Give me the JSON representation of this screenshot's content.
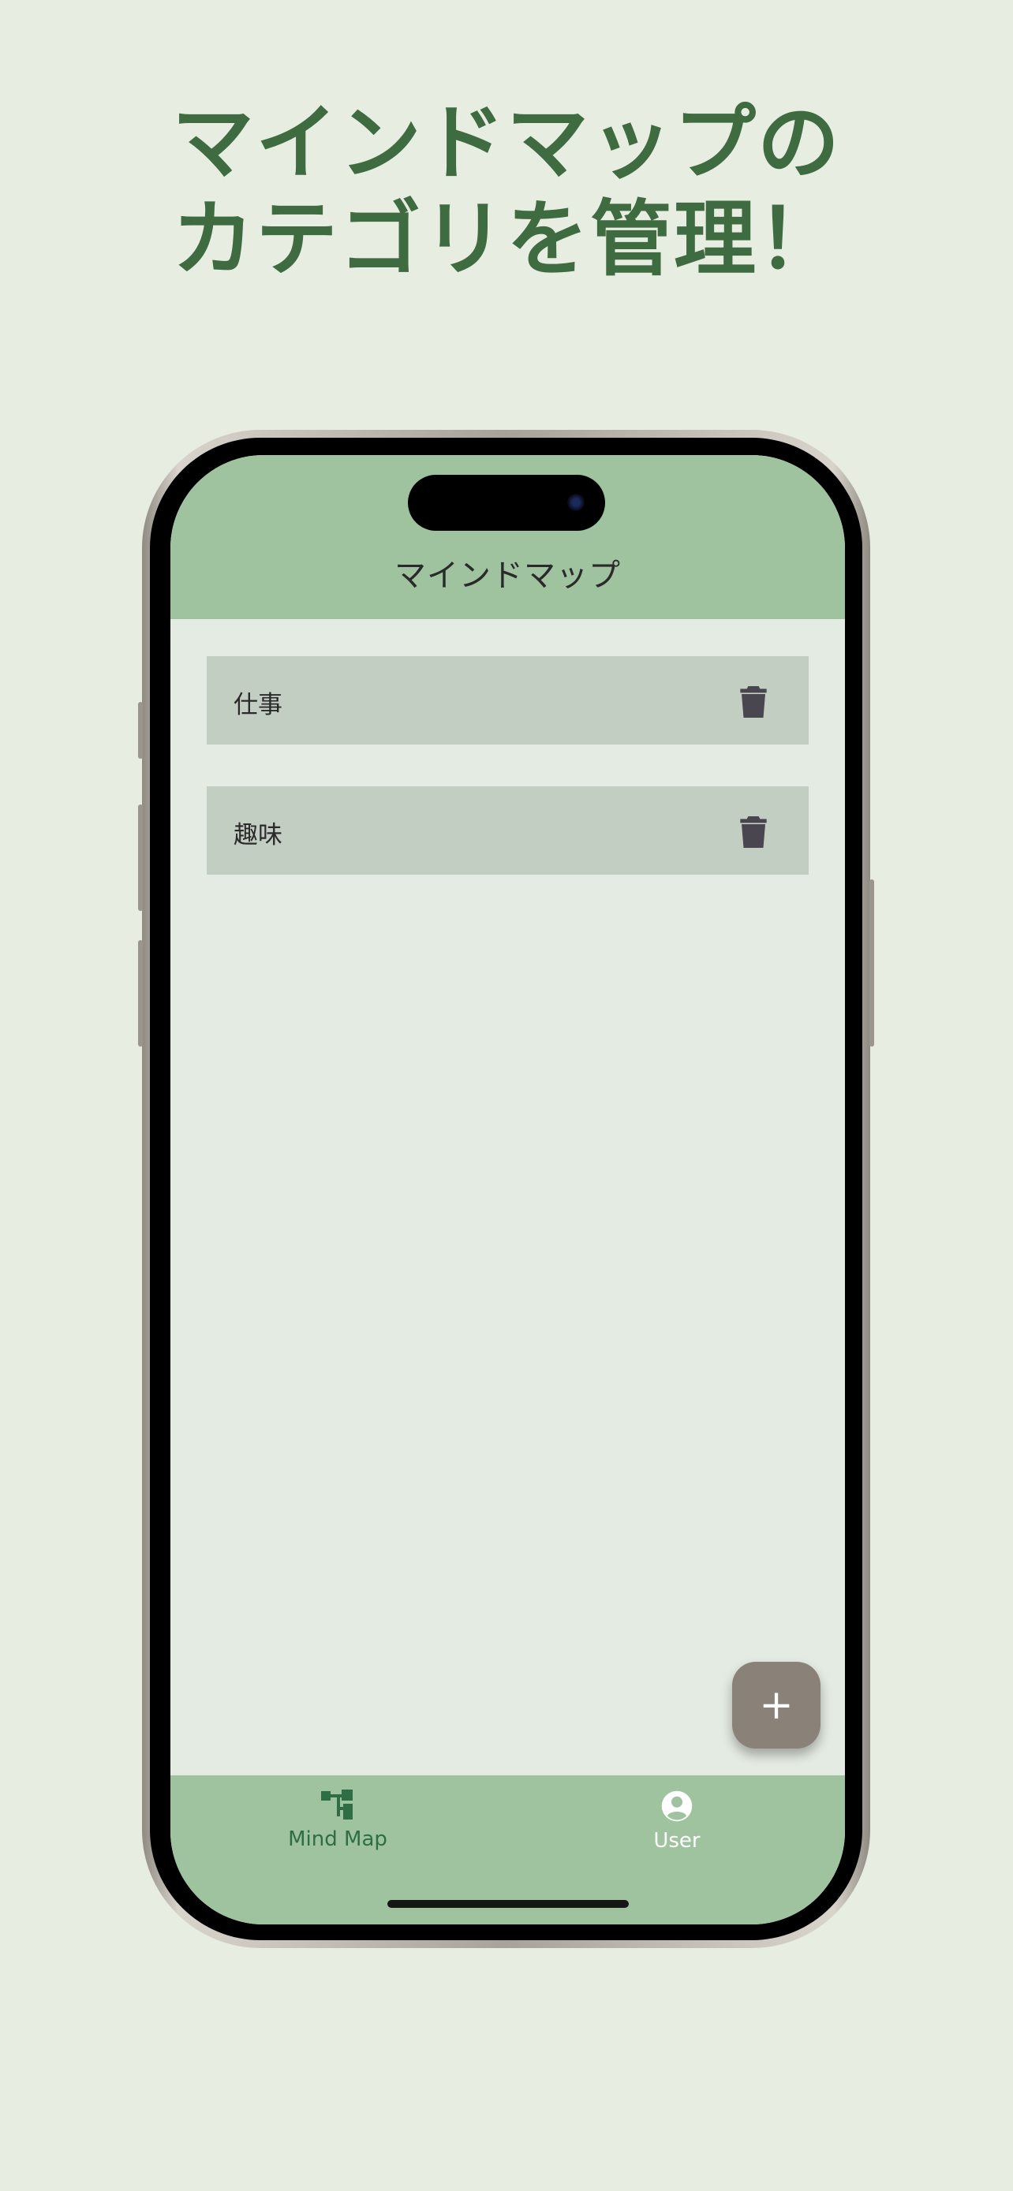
{
  "headline": {
    "line1": "マインドマップの",
    "line2": "カテゴリを管理！"
  },
  "app": {
    "title": "マインドマップ",
    "categories": [
      {
        "label": "仕事",
        "icon": "trash-icon"
      },
      {
        "label": "趣味",
        "icon": "trash-icon"
      }
    ],
    "fab": {
      "label": "+",
      "icon": "plus-icon"
    },
    "bottom_nav": [
      {
        "label": "Mind Map",
        "icon": "mind-map-icon",
        "active": true
      },
      {
        "label": "User",
        "icon": "account-circle-icon",
        "active": false
      }
    ]
  },
  "colors": {
    "background": "#e8ede2",
    "headline": "#3f6b40",
    "app_bar": "#9fc39f",
    "card": "#c3cec2",
    "fab": "#8a8178",
    "nav_active": "#2e6e45",
    "nav_inactive": "#ffffff"
  }
}
